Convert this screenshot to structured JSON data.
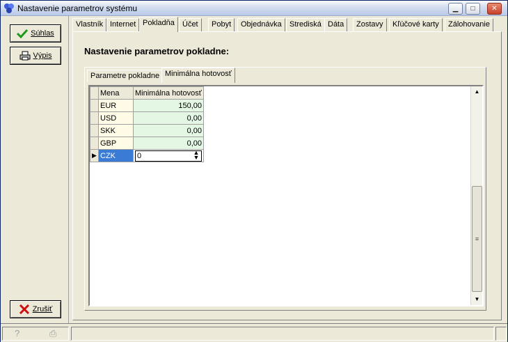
{
  "window": {
    "title": "Nastavenie parametrov systému",
    "minimize_label": "▁",
    "maximize_label": "□",
    "close_label": "✕"
  },
  "side": {
    "ok_label": "Súhlas",
    "print_label": "Výpis",
    "cancel_label": "Zrušiť"
  },
  "tabs": [
    {
      "label": "Vlastník"
    },
    {
      "label": "Internet"
    },
    {
      "label": "Pokladňa"
    },
    {
      "label": "Účet"
    },
    {
      "label": "Pobyt"
    },
    {
      "label": "Objednávka"
    },
    {
      "label": "Strediská"
    },
    {
      "label": "Dáta"
    },
    {
      "label": "Zostavy"
    },
    {
      "label": "Kľúčové karty"
    },
    {
      "label": "Zálohovanie"
    }
  ],
  "active_tab": "Pokladňa",
  "page_heading": "Nastavenie parametrov pokladne:",
  "inner_tabs": [
    {
      "label": "Parametre pokladne"
    },
    {
      "label": "Minimálna hotovosť"
    }
  ],
  "active_inner_tab": "Minimálna hotovosť",
  "grid": {
    "columns": [
      "Mena",
      "Minimálna hotovosť"
    ],
    "rows": [
      {
        "currency": "EUR",
        "amount": "150,00"
      },
      {
        "currency": "USD",
        "amount": "0,00"
      },
      {
        "currency": "SKK",
        "amount": "0,00"
      },
      {
        "currency": "GBP",
        "amount": "0,00"
      },
      {
        "currency": "CZK",
        "amount": "0"
      }
    ],
    "selected_row": 4,
    "row_indicator": "▶"
  },
  "colors": {
    "amount_cell_bg": "#e4f7e4",
    "code_cell_bg": "#fffbe6",
    "selection": "#3a7bd5"
  }
}
